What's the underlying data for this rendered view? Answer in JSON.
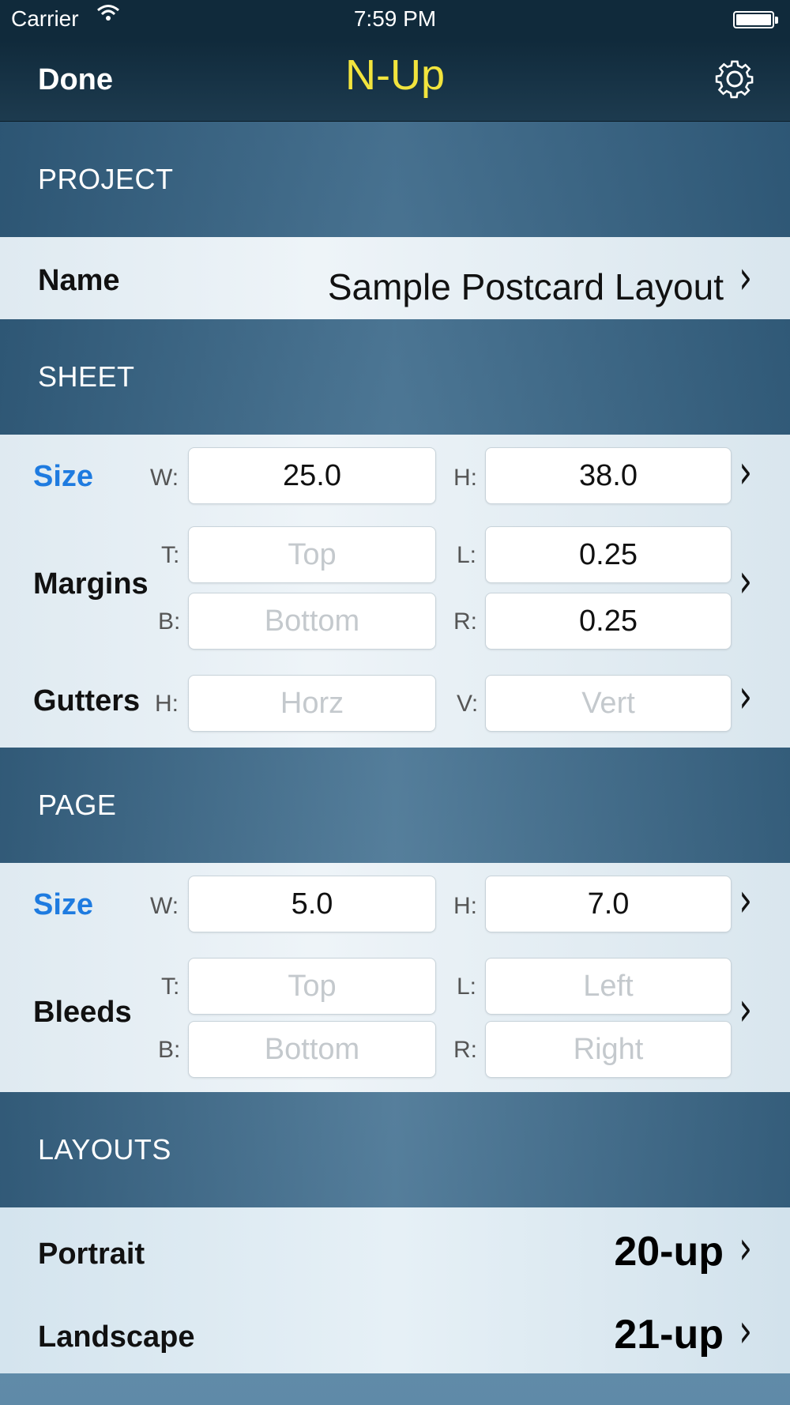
{
  "status_bar": {
    "carrier": "Carrier",
    "time": "7:59 PM"
  },
  "nav": {
    "done_label": "Done",
    "title": "N-Up",
    "settings_icon": "gear-icon",
    "title_color": "#f2e43d"
  },
  "project": {
    "header": "PROJECT",
    "name_label": "Name",
    "name_value": "Sample Postcard Layout"
  },
  "sheet": {
    "header": "SHEET",
    "size": {
      "label": "Size",
      "w_label": "W:",
      "w_value": "25.0",
      "h_label": "H:",
      "h_value": "38.0"
    },
    "margins": {
      "label": "Margins",
      "t_label": "T:",
      "t_placeholder": "Top",
      "l_label": "L:",
      "l_value": "0.25",
      "b_label": "B:",
      "b_placeholder": "Bottom",
      "r_label": "R:",
      "r_value": "0.25"
    },
    "gutters": {
      "label": "Gutters",
      "h_label": "H:",
      "h_placeholder": "Horz",
      "v_label": "V:",
      "v_placeholder": "Vert"
    }
  },
  "page": {
    "header": "PAGE",
    "size": {
      "label": "Size",
      "w_label": "W:",
      "w_value": "5.0",
      "h_label": "H:",
      "h_value": "7.0"
    },
    "bleeds": {
      "label": "Bleeds",
      "t_label": "T:",
      "t_placeholder": "Top",
      "l_label": "L:",
      "l_placeholder": "Left",
      "b_label": "B:",
      "b_placeholder": "Bottom",
      "r_label": "R:",
      "r_placeholder": "Right"
    }
  },
  "layouts": {
    "header": "LAYOUTS",
    "portrait_label": "Portrait",
    "portrait_value": "20-up",
    "landscape_label": "Landscape",
    "landscape_value": "21-up"
  },
  "chevron": "›",
  "accent_color": "#1e7be0"
}
